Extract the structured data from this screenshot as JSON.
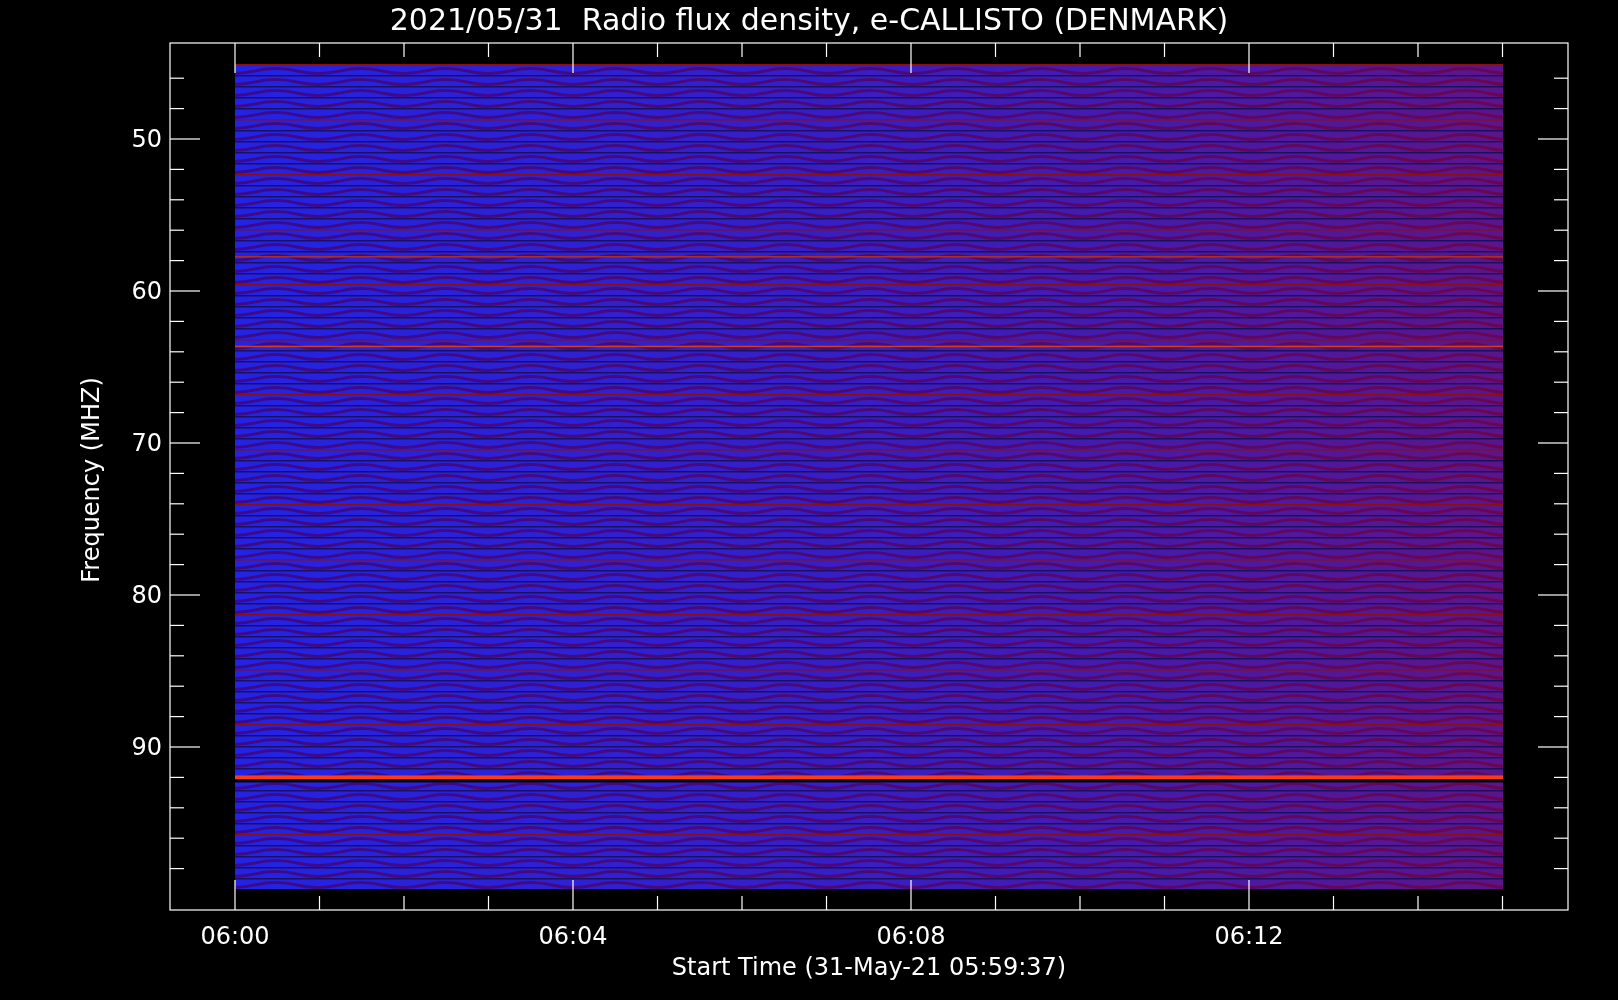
{
  "title": "2021/05/31  Radio flux density, e-CALLISTO (DENMARK)",
  "y_axis": {
    "label": "Frequency (MHZ)",
    "ticks": [
      "50",
      "60",
      "70",
      "80",
      "90"
    ]
  },
  "x_axis": {
    "label": "Start Time (31-May-21 05:59:37)",
    "ticks": [
      "06:00",
      "06:04",
      "06:08",
      "06:12"
    ]
  }
}
